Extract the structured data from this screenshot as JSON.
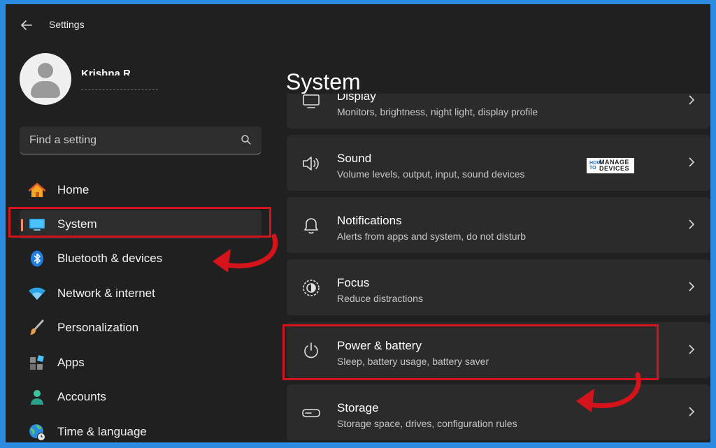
{
  "window": {
    "title": "Settings"
  },
  "profile": {
    "name": "Krishna R"
  },
  "search": {
    "placeholder": "Find a setting"
  },
  "nav": {
    "items": [
      {
        "label": "Home",
        "icon": "home-icon"
      },
      {
        "label": "System",
        "icon": "monitor-icon",
        "selected": true
      },
      {
        "label": "Bluetooth & devices",
        "icon": "bluetooth-icon"
      },
      {
        "label": "Network & internet",
        "icon": "wifi-icon"
      },
      {
        "label": "Personalization",
        "icon": "brush-icon"
      },
      {
        "label": "Apps",
        "icon": "apps-icon"
      },
      {
        "label": "Accounts",
        "icon": "person-icon"
      },
      {
        "label": "Time & language",
        "icon": "globe-clock-icon"
      }
    ]
  },
  "main": {
    "title": "System",
    "cards": [
      {
        "title": "Display",
        "subtitle": "Monitors, brightness, night light, display profile",
        "icon": "display-icon"
      },
      {
        "title": "Sound",
        "subtitle": "Volume levels, output, input, sound devices",
        "icon": "speaker-icon"
      },
      {
        "title": "Notifications",
        "subtitle": "Alerts from apps and system, do not disturb",
        "icon": "bell-icon"
      },
      {
        "title": "Focus",
        "subtitle": "Reduce distractions",
        "icon": "focus-icon"
      },
      {
        "title": "Power & battery",
        "subtitle": "Sleep, battery usage, battery saver",
        "icon": "power-icon"
      },
      {
        "title": "Storage",
        "subtitle": "Storage space, drives, configuration rules",
        "icon": "storage-icon"
      }
    ]
  },
  "watermark": {
    "line1": "HOW TO",
    "line2": "MANAGE DEVICES"
  },
  "colors": {
    "accent": "#4cc2ff",
    "highlight": "#d4131b",
    "selected_bar": "#f08a6e"
  }
}
